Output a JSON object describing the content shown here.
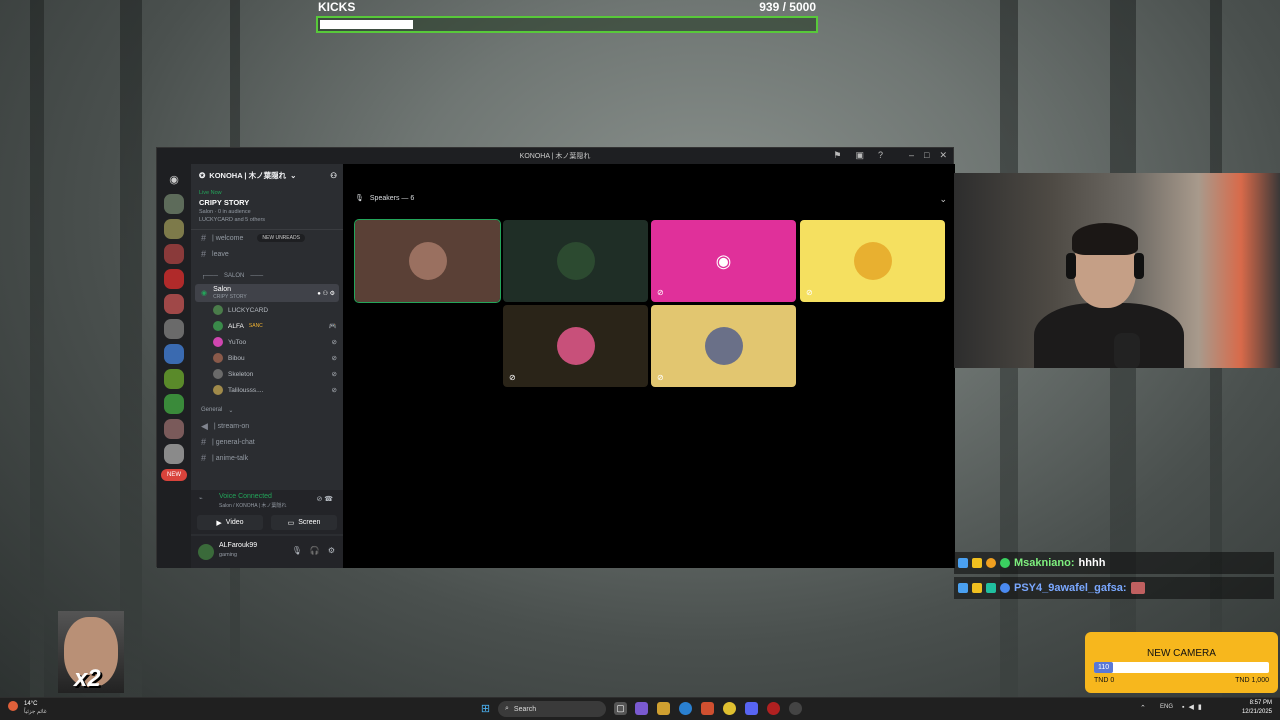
{
  "kicks": {
    "label": "KICKS",
    "count": "939",
    "sep": " / ",
    "goal": "5000",
    "progress": 0.1878
  },
  "window": {
    "title": "KONOHA | 木ノ葉隠れ",
    "server_name": "KONOHA | 木ノ葉隠れ",
    "live_now_label": "Live Now",
    "stage_title": "CRIPY STORY",
    "stage_meta": "Salon · 0 in audience",
    "stage_people": "LUCKYCARD and 5 others",
    "new_unreads": "NEW UNREADS",
    "channels_top": [
      {
        "name": "| welcome"
      },
      {
        "name": "leave"
      }
    ],
    "category_salon": "SALON",
    "voice_channel": {
      "name": "Salon",
      "sub": "CRIPY STORY"
    },
    "voice_users": [
      {
        "name": "LUCKYCARD",
        "color": "#4a7c4a"
      },
      {
        "name": "ALFA",
        "tag": "SANC",
        "color": "#3a8a4a"
      },
      {
        "name": "YuToo",
        "color": "#d046b0"
      },
      {
        "name": "Bibou",
        "color": "#8a5a4a"
      },
      {
        "name": "Skeleton",
        "color": "#6a6a6a"
      },
      {
        "name": "Talilousss....",
        "color": "#a08a4a"
      }
    ],
    "category_general": "General",
    "general_channels": [
      {
        "name": "| stream-on"
      },
      {
        "name": "| general-chat"
      },
      {
        "name": "| anime-talk"
      }
    ],
    "server_badge": "NEW",
    "voice_connected": "Voice Connected",
    "voice_location": "Salon / KONOHA | 木ノ葉隠れ",
    "video_label": "Video",
    "screen_label": "Screen",
    "username": "ALFarouk99",
    "status": "gaming",
    "speakers_label": "Speakers — 6"
  },
  "tiles": [
    {
      "bg": "#5a4036",
      "avatar": "#9a7060",
      "muted": false,
      "active": true
    },
    {
      "bg": "#1f2e26",
      "avatar": "#2c4a30",
      "muted": false,
      "active": false
    },
    {
      "bg": "#e0309a",
      "avatar": "#e0309a",
      "muted": true,
      "active": false
    },
    {
      "bg": "#f5e060",
      "avatar": "#e8b030",
      "muted": true,
      "active": false
    },
    {
      "bg": "#2a2418",
      "avatar": "#c8507a",
      "muted": true,
      "active": false
    },
    {
      "bg": "#e2c670",
      "avatar": "#6a7088",
      "muted": true,
      "active": false
    }
  ],
  "chat": [
    {
      "user": "Msakniano",
      "text": "hhhh",
      "color": "#7ef07e"
    },
    {
      "user": "PSY4_9awafel_gafsa",
      "text": "",
      "color": "#7aa8ff"
    }
  ],
  "overlay": {
    "x2": "x2"
  },
  "new_camera": {
    "title": "NEW CAMERA",
    "current": "110",
    "left": "TND 0",
    "right": "TND 1,000",
    "progress": 0.11
  },
  "taskbar": {
    "search": "Search",
    "weather_temp": "14°C",
    "weather_desc": "غائم جزئياً",
    "lang": "ENG",
    "time": "8:57 PM",
    "date": "12/21/2025"
  }
}
